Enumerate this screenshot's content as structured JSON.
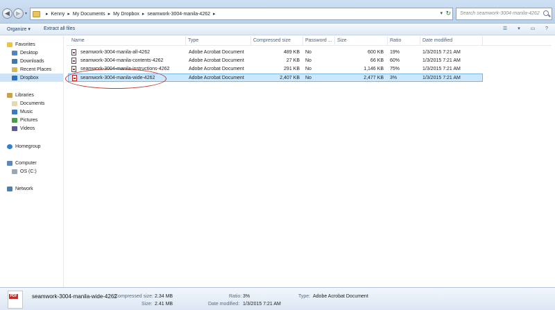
{
  "address": {
    "crumbs": [
      "Kenny",
      "My Documents",
      "My Dropbox",
      "seamwork-3004-manila-4262"
    ],
    "search_placeholder": "Search seamwork-3004-manila-4262"
  },
  "toolbar": {
    "organize": "Organize ▾",
    "extract": "Extract all files"
  },
  "sidebar": {
    "favorites": "Favorites",
    "desktop": "Desktop",
    "downloads": "Downloads",
    "recent": "Recent Places",
    "dropbox": "Dropbox",
    "libraries": "Libraries",
    "documents": "Documents",
    "music": "Music",
    "pictures": "Pictures",
    "videos": "Videos",
    "homegroup": "Homegroup",
    "computer": "Computer",
    "osc": "OS (C:)",
    "network": "Network"
  },
  "columns": {
    "name": "Name",
    "type": "Type",
    "compressed": "Compressed size",
    "password": "Password ...",
    "size": "Size",
    "ratio": "Ratio",
    "date": "Date modified"
  },
  "files": [
    {
      "name": "seamwork-3004-manila-all-4262",
      "type": "Adobe Acrobat Document",
      "compressed": "489 KB",
      "password": "No",
      "size": "600 KB",
      "ratio": "19%",
      "date": "1/3/2015 7:21 AM"
    },
    {
      "name": "seamwork-3004-manila-contents-4262",
      "type": "Adobe Acrobat Document",
      "compressed": "27 KB",
      "password": "No",
      "size": "66 KB",
      "ratio": "60%",
      "date": "1/3/2015 7:21 AM"
    },
    {
      "name": "seamwork-3004-manila-instructions-4262",
      "type": "Adobe Acrobat Document",
      "compressed": "291 KB",
      "password": "No",
      "size": "1,146 KB",
      "ratio": "75%",
      "date": "1/3/2015 7:21 AM"
    },
    {
      "name": "seamwork-3004-manila-wide-4262",
      "type": "Adobe Acrobat Document",
      "compressed": "2,407 KB",
      "password": "No",
      "size": "2,477 KB",
      "ratio": "3%",
      "date": "1/3/2015 7:21 AM"
    }
  ],
  "details": {
    "icon_label": "PDF",
    "name": "seamwork-3004-manila-wide-4262",
    "compressed_label": "Compressed size:",
    "compressed_value": "2.34 MB",
    "size_label": "Size:",
    "size_value": "2.41 MB",
    "ratio_label": "Ratio:",
    "ratio_value": "3%",
    "date_label": "Date modified:",
    "date_value": "1/3/2015 7:21 AM",
    "type_label": "Type:",
    "type_value": "Adobe Acrobat Document"
  },
  "colors": {
    "selection": "#cce8ff",
    "annotation": "#c0392b"
  }
}
